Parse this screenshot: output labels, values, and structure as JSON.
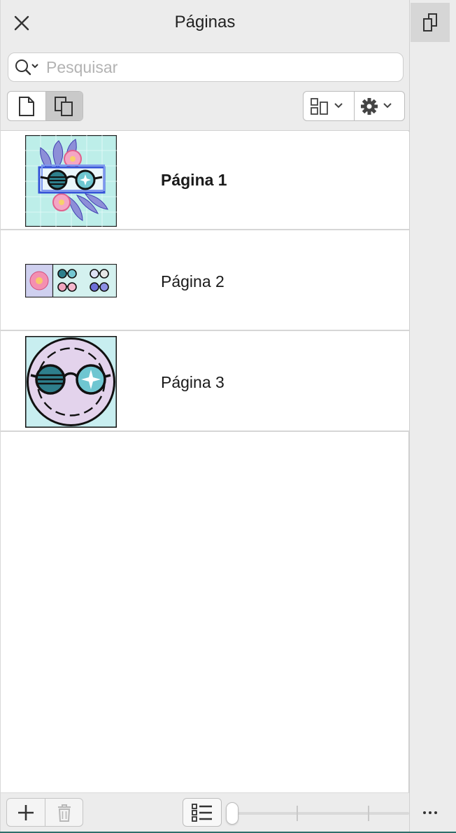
{
  "panel": {
    "title": "Páginas",
    "search": {
      "placeholder": "Pesquisar",
      "value": ""
    }
  },
  "toolbar": {
    "view_buttons": [
      "single-page-view",
      "multi-page-view"
    ],
    "active_view": "multi-page-view",
    "layout_menu": "layout-options",
    "settings_menu": "gear-options"
  },
  "pages": [
    {
      "label": "Página 1",
      "active": true,
      "thumbnail": "page-1-thumbnail"
    },
    {
      "label": "Página 2",
      "active": false,
      "thumbnail": "page-2-thumbnail"
    },
    {
      "label": "Página 3",
      "active": false,
      "thumbnail": "page-3-thumbnail"
    }
  ],
  "footer": {
    "add": "plus-icon",
    "delete": "trash-icon",
    "list_view": "list-icon",
    "thumbnail_size": 0
  },
  "rail": {
    "docked_panel": "pages-panel-icon",
    "more": "ellipsis-icon"
  },
  "colors": {
    "panel_bg": "#ececec",
    "selected_segment": "#c9c9c9",
    "thumb_mint": "#bfece8",
    "thumb_lavender": "#e3d3ec",
    "thumb_pink": "#f48fb1"
  }
}
